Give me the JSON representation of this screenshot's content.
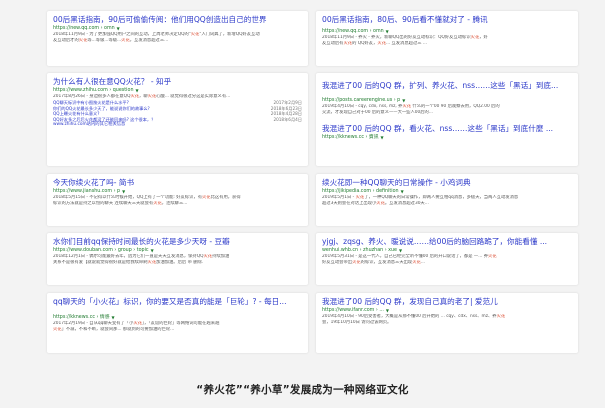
{
  "left": [
    {
      "title": "00后黑话指南，90后可偷偷传阅：他们用QQ创造出自己的世界",
      "url": "https://new.qq.com › omn",
      "snippet": [
        "2018年11月9日 - 为了更加强QQ用户之间的互动，上周老师决定QQ的\"火花\"入门词典了，新增QQ好友互动",
        "友互动后才的火花等...等级...等级...火花，互发消息超过三..."
      ]
    },
    {
      "title": "为什么有人很在意QQ火花？ - 知乎",
      "url": "https://www.zhihu.com › question",
      "snippet": [
        "2017年8月26日 - 身边很多人都在意QQ火花，聊火花心酸... 就觉得很过分这是实际意义有..."
      ],
      "rows": [
        {
          "q": "QQ聊天标识中有小图按火花是什么水平?",
          "d": "2017年2月9日"
        },
        {
          "q": "你们的QQ火花最长多少天了，能说说你们的故事么?",
          "d": "2018年6月23日"
        },
        {
          "q": "QQ上曝火花有什么意义?",
          "d": "2018年4月28日"
        },
        {
          "q": "QQ好友多之后后火花都没了还能回来吗? 这个很本，？",
          "d": "2018年6月4日"
        }
      ],
      "sublink": "www.zhihu.com站内的其它相关信息"
    },
    {
      "title": "今天你续火花了吗- 简书",
      "url": "https://www.jianshu.com › p",
      "snippet": [
        "2018年5月15日 - 不记得以什么时候开始，QQ上有了一个功能: 好友标识，有火花比这有用，获得",
        "标识的方法就是持之以恒的聊天 连续聊天三天就会有火花，连续聊三..."
      ]
    },
    {
      "title": "水你们目前qq保持时间最长的火花是多少天呀 - 豆瓣",
      "url": "https://www.douban.com › group › topic",
      "snippet": [
        "2018年12月1日 - 偶尔可能最好去年，因为它们一直是天天互发消息，保持QQ火花持续加油",
        "关系不是很有爱【就说就觉得很好就是给我续命刷火花加油加油。后后 带 删除."
      ]
    },
    {
      "title": "qq聊天的「小火花」标识，你的要又是否真的能是「巨轮」? - 每日...",
      "url": "https://kknews.cc › 情感",
      "snippet": [
        "2017年2月19日 - 自从qq聊天变有了「小火花」，「友谊的巨轮」等网络词可能在越来越",
        "火花」不减，不和不断，就会同那... 那就到的可要加油的巨轮..."
      ]
    }
  ],
  "right": [
    {
      "title": "00后黑话指南，80后、90后看不懂就对了 - 腾讯",
      "url": "https://new.qq.com › omn",
      "snippet": [
        "2018年11月9日 - 养火 - 养火，新聊QQ出的好友互动标识：QQ好友互动标识火花，好",
        "友互动后有火花的 QQ好友，火花... 互发消息超过三 ..."
      ]
    },
    {
      "title": "我混进了00 后的QQ 群，扩列、养火花、nss……这些「黑话」到底...",
      "url": "https://posts.careerengine.us › p",
      "snippet": [
        "2019年4月10日 - cqy, cdx, nss, mz, 养火花 什么的一个00 90 后观察去用，QQ2.00 后的",
        "交流，才发现自己对于00 后的意义——大一些人00后的..."
      ]
    },
    {
      "title": "我混进了00 后的QQ 群，看火花、nss……这些「黑话」到底什麼 ...",
      "url": "https://kknews.cc › 資訊",
      "snippet": []
    },
    {
      "title": "续火花即一种QQ聊天的日常操作 - 小鸡词典",
      "url": "https://jikipedia.com › definition",
      "snippet": [
        "2019年5月1日 - 火花了，一种QQ聊天的日常操作，即两人要互相qq消息，多极天，当两人互动发消息",
        "超过3天则会在对话上出现小火花。互发消息超过30天..."
      ]
    },
    {
      "title": "yjgj、zqsg、养火、暖说说……给00后的脑回路跪了，你能看懂 ...",
      "url": "wenhui.whb.cn › zhuzhan › xue",
      "snippet": [
        "2019年5月31日 - 是这一代人，自己已经完全听不懂00 后的开口说话了，都是 —... 养火花",
        "好友互动会带出火花的标识，互发消息三天出现火花..."
      ]
    },
    {
      "title": "我混进了00 后的QQ 群，发现自己真的老了| 爱范儿",
      "url": "https://www.ifanr.com › ...",
      "snippet": [
        "2019年4月10日 - 90后受害者，大概是从那不懂00 后开始的 ... cqy、cdx、nss、mz、养火花",
        "会，19年10月10日 访问过该网页。"
      ]
    }
  ],
  "caption": "“养火花”“养小草”发展成为一种网络亚文化",
  "colors": {
    "title": "#2b38c9",
    "url": "#1f7a2e",
    "highlight": "#d9462b"
  }
}
